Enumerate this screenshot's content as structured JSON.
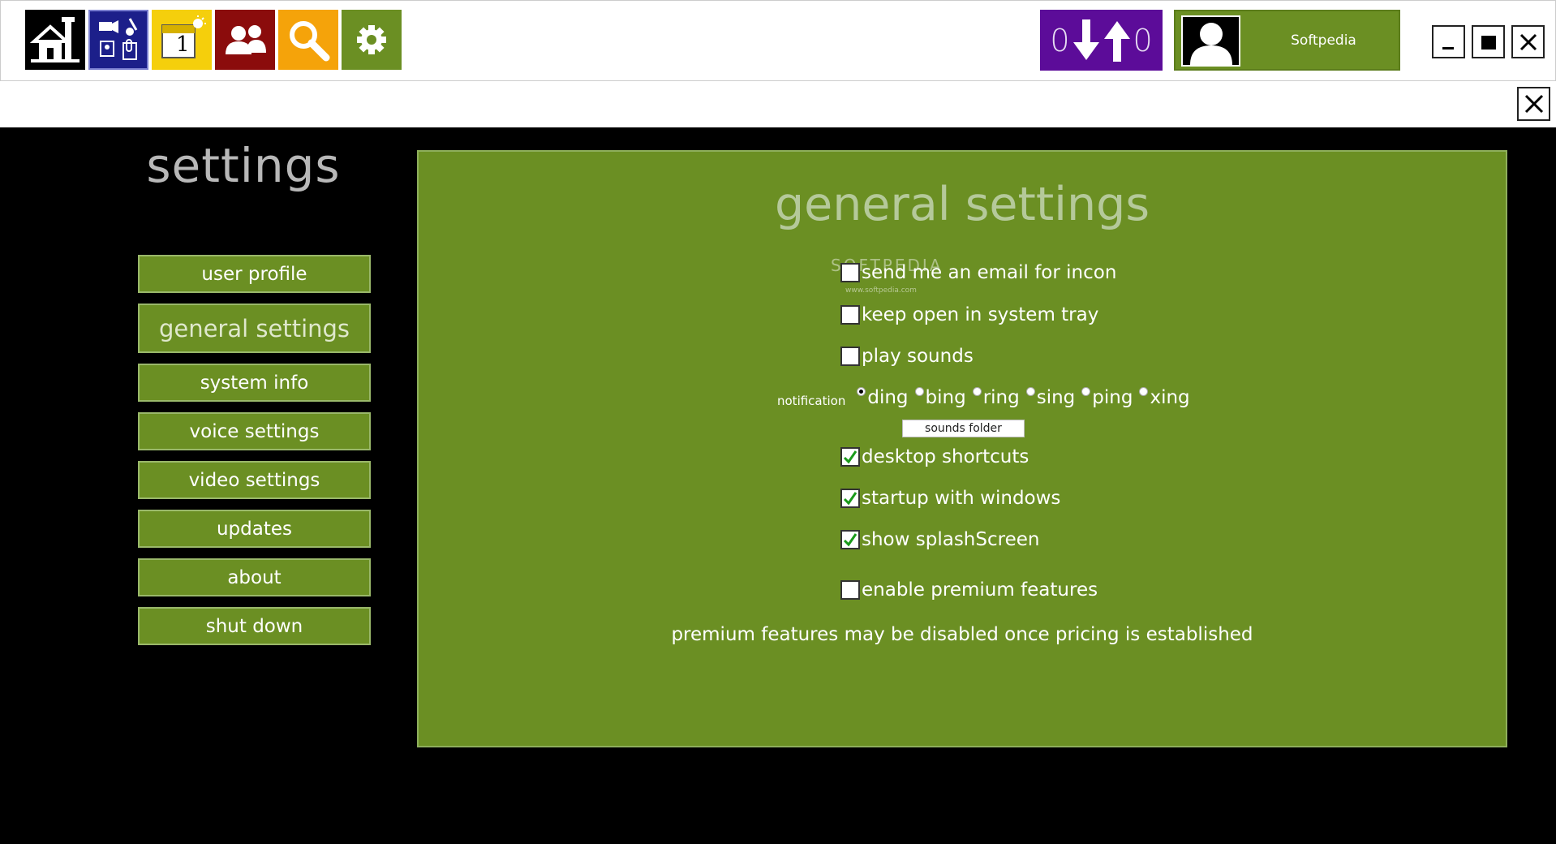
{
  "app": {
    "username": "Softpedia",
    "download_count": "0",
    "upload_count": "0"
  },
  "toolbar": {
    "tiles": [
      {
        "name": "home",
        "color": "#000000"
      },
      {
        "name": "media",
        "color": "#1c1f8a"
      },
      {
        "name": "calendar",
        "color": "#f5cf0c"
      },
      {
        "name": "contacts",
        "color": "#8b0c0c"
      },
      {
        "name": "search",
        "color": "#f5a30a"
      },
      {
        "name": "settings",
        "color": "#6b8f23"
      }
    ],
    "calendar_day": "1"
  },
  "sidebar": {
    "title": "settings",
    "items": [
      {
        "label": "user profile"
      },
      {
        "label": "general settings",
        "active": true
      },
      {
        "label": "system info"
      },
      {
        "label": "voice settings"
      },
      {
        "label": "video settings"
      },
      {
        "label": "updates"
      },
      {
        "label": "about"
      },
      {
        "label": "shut down"
      }
    ]
  },
  "panel": {
    "title": "general settings",
    "watermark": "SOFTPEDIA",
    "watermark_url": "www.softpedia.com",
    "options": {
      "email": {
        "label": "send me an email for incon",
        "checked": false
      },
      "tray": {
        "label": "keep open in system tray",
        "checked": false
      },
      "sounds": {
        "label": "play sounds",
        "checked": false
      },
      "shortcuts": {
        "label": "desktop shortcuts",
        "checked": true
      },
      "startup": {
        "label": "startup with windows",
        "checked": true
      },
      "splash": {
        "label": "show splashScreen",
        "checked": true
      },
      "premium": {
        "label": "enable premium features",
        "checked": false
      }
    },
    "notification": {
      "label": "notification",
      "options": [
        "ding",
        "bing",
        "ring",
        "sing",
        "ping",
        "xing"
      ],
      "selected": "ding"
    },
    "sounds_folder_label": "sounds folder",
    "premium_note": "premium features may be disabled once pricing is established"
  },
  "colors": {
    "accent_green": "#6b8f23",
    "counter_purple": "#5c0c99",
    "check_green": "#1a9a1a"
  }
}
